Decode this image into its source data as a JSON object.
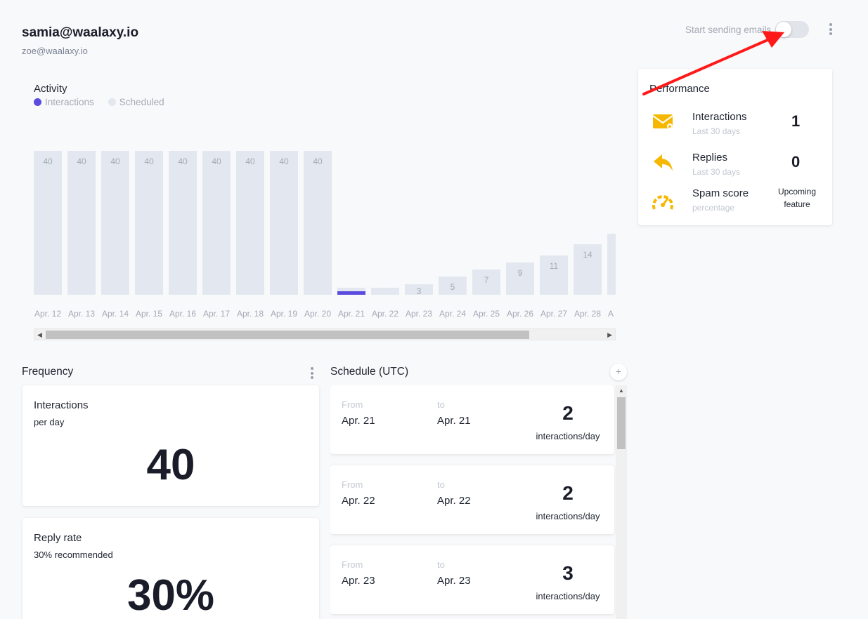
{
  "header": {
    "email": "samia@waalaxy.io",
    "sub_email": "zoe@waalaxy.io"
  },
  "toggle": {
    "label": "Start sending emails",
    "on": false
  },
  "activity": {
    "title": "Activity",
    "legend": [
      {
        "label": "Interactions",
        "color": "#5b4ce0"
      },
      {
        "label": "Scheduled",
        "color": "#e3e8f0"
      }
    ]
  },
  "chart_data": {
    "type": "bar",
    "categories": [
      "Apr. 12",
      "Apr. 13",
      "Apr. 14",
      "Apr. 15",
      "Apr. 16",
      "Apr. 17",
      "Apr. 18",
      "Apr. 19",
      "Apr. 20",
      "Apr. 21",
      "Apr. 22",
      "Apr. 23",
      "Apr. 24",
      "Apr. 25",
      "Apr. 26",
      "Apr. 27",
      "Apr. 28",
      "A"
    ],
    "series": [
      {
        "name": "Scheduled",
        "values": [
          40,
          40,
          40,
          40,
          40,
          40,
          40,
          40,
          40,
          2,
          2,
          3,
          5,
          7,
          9,
          11,
          14,
          17
        ]
      },
      {
        "name": "Interactions",
        "values": [
          0,
          0,
          0,
          0,
          0,
          0,
          0,
          0,
          0,
          1,
          0,
          0,
          0,
          0,
          0,
          0,
          0,
          0
        ]
      }
    ],
    "data_labels": [
      "40",
      "40",
      "40",
      "40",
      "40",
      "40",
      "40",
      "40",
      "40",
      "",
      "",
      "3",
      "5",
      "7",
      "9",
      "11",
      "14",
      ""
    ],
    "ylim": [
      0,
      40
    ],
    "grid": false,
    "legend": "top-left"
  },
  "performance": {
    "title": "Performance",
    "rows": [
      {
        "label": "Interactions",
        "sub": "Last 30 days",
        "value": "1",
        "icon": "mail-star-icon"
      },
      {
        "label": "Replies",
        "sub": "Last 30 days",
        "value": "0",
        "icon": "reply-icon"
      },
      {
        "label": "Spam score",
        "sub": "percentage",
        "value": "Upcoming feature",
        "icon": "speedometer-icon"
      }
    ],
    "icon_color": "#f5b700"
  },
  "frequency": {
    "title": "Frequency",
    "cards": [
      {
        "title": "Interactions",
        "sub": "per day",
        "value": "40"
      },
      {
        "title": "Reply rate",
        "sub": "30% recommended",
        "value": "30%"
      }
    ]
  },
  "schedule": {
    "title": "Schedule (UTC)",
    "add_label": "+",
    "from_label": "From",
    "to_label": "to",
    "unit": "interactions/day",
    "items": [
      {
        "from": "Apr. 21",
        "to": "Apr. 21",
        "count": "2"
      },
      {
        "from": "Apr. 22",
        "to": "Apr. 22",
        "count": "2"
      },
      {
        "from": "Apr. 23",
        "to": "Apr. 23",
        "count": "3"
      }
    ]
  }
}
